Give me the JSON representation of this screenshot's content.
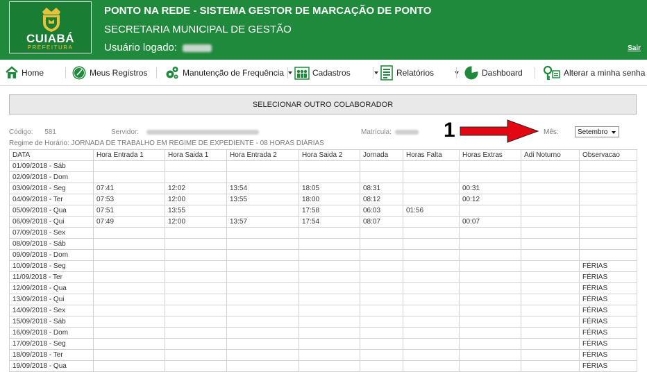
{
  "header": {
    "logo_name": "CUIABÁ",
    "logo_sub": "PREFEITURA",
    "title": "PONTO NA REDE - SISTEMA GESTOR DE MARCAÇÃO DE PONTO",
    "subtitle": "SECRETARIA MUNICIPAL DE GESTÃO",
    "user_label": "Usuário logado:",
    "exit_label": "Sair"
  },
  "nav": {
    "home": "Home",
    "records": "Meus Registros",
    "maintenance": "Manutenção de Frequência",
    "registers": "Cadastros",
    "reports": "Relatórios",
    "dashboard": "Dashboard",
    "password": "Alterar a minha senha"
  },
  "select_button": "SELECIONAR OUTRO COLABORADOR",
  "info": {
    "code_label": "Código:",
    "code_value": "581",
    "server_label": "Servidor:",
    "registration_label": "Matrícula:",
    "regime": "Regime de Horário: JORNADA DE TRABALHO EM REGIME DE EXPEDIENTE - 08 HORAS DIÁRIAS"
  },
  "annotation": "1",
  "month": {
    "label": "Mês:",
    "selected": "Setembro"
  },
  "table": {
    "columns": [
      "DATA",
      "Hora Entrada 1",
      "Hora Saida 1",
      "Hora Entrada 2",
      "Hora Saida 2",
      "Jornada",
      "Horas Falta",
      "Horas Extras",
      "Adi Noturno",
      "Observacao"
    ],
    "rows": [
      [
        "01/09/2018 - Sáb",
        "",
        "",
        "",
        "",
        "",
        "",
        "",
        "",
        ""
      ],
      [
        "02/09/2018 - Dom",
        "",
        "",
        "",
        "",
        "",
        "",
        "",
        "",
        ""
      ],
      [
        "03/09/2018 - Seg",
        "07:41",
        "12:02",
        "13:54",
        "18:05",
        "08:31",
        "",
        "00:31",
        "",
        ""
      ],
      [
        "04/09/2018 - Ter",
        "07:53",
        "12:00",
        "13:55",
        "18:00",
        "08:12",
        "",
        "00:12",
        "",
        ""
      ],
      [
        "05/09/2018 - Qua",
        "07:51",
        "13:55",
        "",
        "17:58",
        "06:03",
        "01:56",
        "",
        "",
        ""
      ],
      [
        "06/09/2018 - Qui",
        "07:49",
        "12:00",
        "13:57",
        "17:54",
        "08:07",
        "",
        "00:07",
        "",
        ""
      ],
      [
        "07/09/2018 - Sex",
        "",
        "",
        "",
        "",
        "",
        "",
        "",
        "",
        ""
      ],
      [
        "08/09/2018 - Sáb",
        "",
        "",
        "",
        "",
        "",
        "",
        "",
        "",
        ""
      ],
      [
        "09/09/2018 - Dom",
        "",
        "",
        "",
        "",
        "",
        "",
        "",
        "",
        ""
      ],
      [
        "10/09/2018 - Seg",
        "",
        "",
        "",
        "",
        "",
        "",
        "",
        "",
        "FÉRIAS"
      ],
      [
        "11/09/2018 - Ter",
        "",
        "",
        "",
        "",
        "",
        "",
        "",
        "",
        "FÉRIAS"
      ],
      [
        "12/09/2018 - Qua",
        "",
        "",
        "",
        "",
        "",
        "",
        "",
        "",
        "FÉRIAS"
      ],
      [
        "13/09/2018 - Qui",
        "",
        "",
        "",
        "",
        "",
        "",
        "",
        "",
        "FÉRIAS"
      ],
      [
        "14/09/2018 - Sex",
        "",
        "",
        "",
        "",
        "",
        "",
        "",
        "",
        "FÉRIAS"
      ],
      [
        "15/09/2018 - Sáb",
        "",
        "",
        "",
        "",
        "",
        "",
        "",
        "",
        "FÉRIAS"
      ],
      [
        "16/09/2018 - Dom",
        "",
        "",
        "",
        "",
        "",
        "",
        "",
        "",
        "FÉRIAS"
      ],
      [
        "17/09/2018 - Seg",
        "",
        "",
        "",
        "",
        "",
        "",
        "",
        "",
        "FÉRIAS"
      ],
      [
        "18/09/2018 - Ter",
        "",
        "",
        "",
        "",
        "",
        "",
        "",
        "",
        "FÉRIAS"
      ],
      [
        "19/09/2018 - Qua",
        "",
        "",
        "",
        "",
        "",
        "",
        "",
        "",
        "FÉRIAS"
      ]
    ]
  }
}
